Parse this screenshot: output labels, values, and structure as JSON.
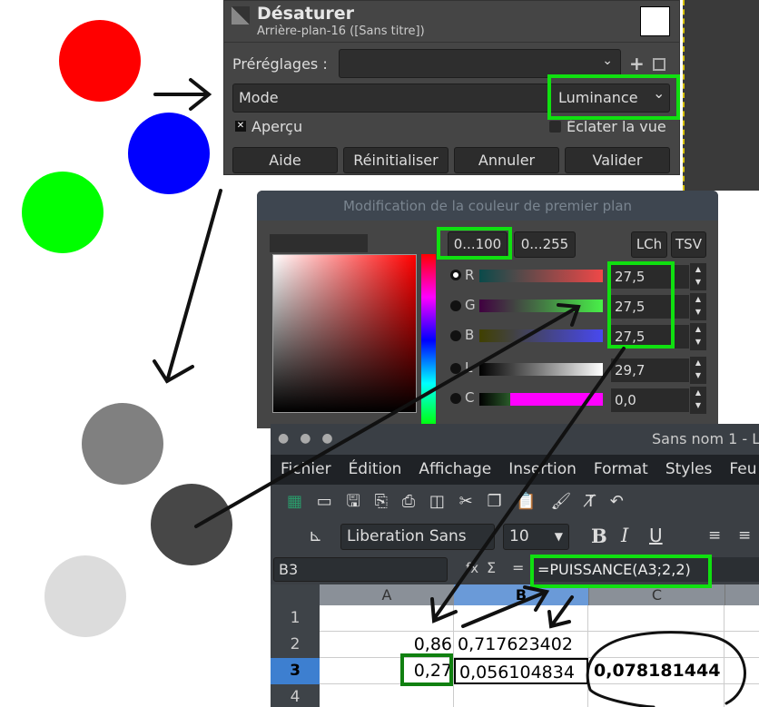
{
  "colors": {
    "red": "#ff0000",
    "blue": "#0000ff",
    "green": "#00ff00",
    "gray": "#808080",
    "dark_gray": "#474747",
    "light_gray": "#dcdcdc",
    "highlight": "#10e010"
  },
  "desaturate": {
    "title": "Désaturer",
    "subtitle": "Arrière-plan-16 ([Sans titre])",
    "presets_label": "Préréglages :",
    "presets_value": "",
    "mode_label": "Mode",
    "mode_value": "Luminance",
    "preview_label": "Aperçu",
    "preview_checked": true,
    "split_label": "Éclater la vue",
    "split_checked": false,
    "buttons": [
      "Aide",
      "Réinitialiser",
      "Annuler",
      "Valider"
    ]
  },
  "color_dialog": {
    "title": "Modification de la couleur de premier plan",
    "range_buttons": [
      "0...100",
      "0...255"
    ],
    "mode_buttons": [
      "LCh",
      "TSV"
    ],
    "channels": [
      {
        "label": "R",
        "value": "27,5",
        "selected": true
      },
      {
        "label": "G",
        "value": "27,5"
      },
      {
        "label": "B",
        "value": "27,5"
      },
      {
        "label": "L",
        "value": "29,7"
      },
      {
        "label": "C",
        "value": "0,0"
      }
    ]
  },
  "calc": {
    "title": "Sans nom 1 - L",
    "menu": [
      "Fichier",
      "Édition",
      "Affichage",
      "Insertion",
      "Format",
      "Styles",
      "Feu"
    ],
    "font_name": "Liberation Sans",
    "font_size": "10",
    "cell_ref": "B3",
    "formula": "=PUISSANCE(A3;2,2)",
    "columns": [
      "A",
      "B",
      "C"
    ],
    "rows": [
      "1",
      "2",
      "3",
      "4"
    ],
    "cells": {
      "A2": "0,86",
      "B2": "0,717623402",
      "A3": "0,27",
      "B3": "0,056104834",
      "C3": "0,078181444"
    }
  }
}
